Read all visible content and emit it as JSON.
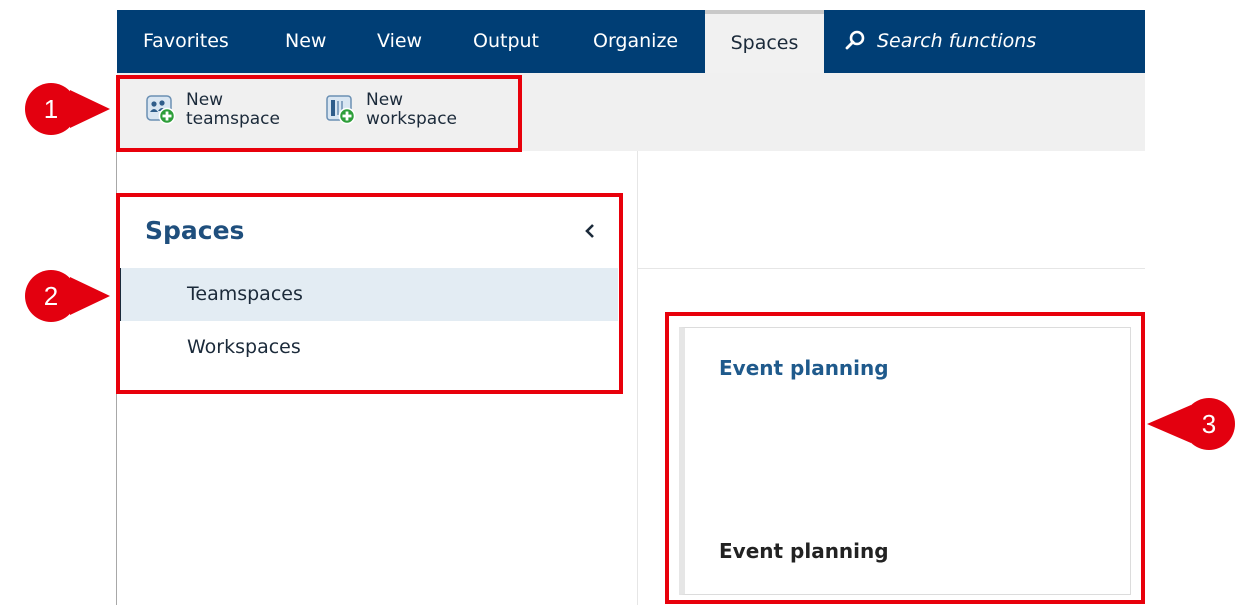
{
  "nav": {
    "tabs": [
      {
        "label": "Favorites"
      },
      {
        "label": "New"
      },
      {
        "label": "View"
      },
      {
        "label": "Output"
      },
      {
        "label": "Organize"
      },
      {
        "label": "Spaces",
        "active": true
      }
    ],
    "search_label": "Search functions",
    "search_icon": "search-icon"
  },
  "ribbon": {
    "new_teamspace": {
      "line1": "New",
      "line2": "teamspace",
      "icon": "teamspace-add-icon"
    },
    "new_workspace": {
      "line1": "New",
      "line2": "workspace",
      "icon": "workspace-add-icon"
    }
  },
  "sidebar": {
    "title": "Spaces",
    "collapse_icon": "chevron-left-icon",
    "items": [
      {
        "label": "Teamspaces",
        "selected": true
      },
      {
        "label": "Workspaces",
        "selected": false
      }
    ]
  },
  "card": {
    "link": "Event planning",
    "name": "Event planning"
  },
  "callouts": [
    "1",
    "2",
    "3"
  ],
  "colors": {
    "nav_bg": "#003e75",
    "accent_text": "#1f4f7d",
    "highlight_frame": "#e8000b",
    "selected_bg": "#e3ecf3"
  }
}
